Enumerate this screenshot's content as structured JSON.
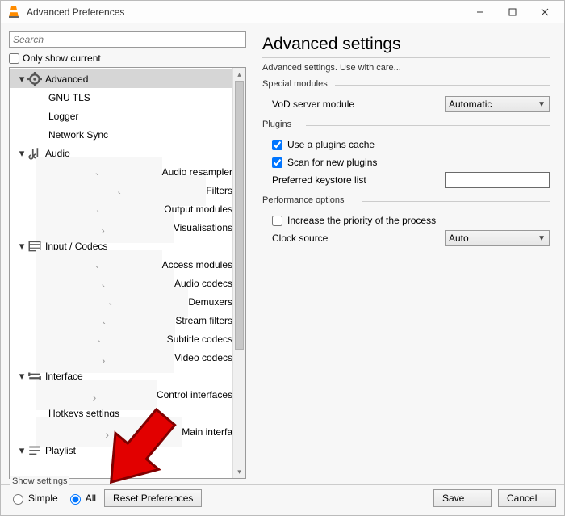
{
  "window": {
    "title": "Advanced Preferences"
  },
  "search": {
    "placeholder": "Search"
  },
  "only_current_label": "Only show current",
  "tree": {
    "advanced": {
      "label": "Advanced"
    },
    "gnu_tls": {
      "label": "GNU TLS"
    },
    "logger": {
      "label": "Logger"
    },
    "network_sync": {
      "label": "Network Sync"
    },
    "audio": {
      "label": "Audio"
    },
    "audio_resampler": {
      "label": "Audio resampler"
    },
    "filters": {
      "label": "Filters"
    },
    "output_modules": {
      "label": "Output modules"
    },
    "visualisations": {
      "label": "Visualisations"
    },
    "input_codecs": {
      "label": "Input / Codecs"
    },
    "access_modules": {
      "label": "Access modules"
    },
    "audio_codecs": {
      "label": "Audio codecs"
    },
    "demuxers": {
      "label": "Demuxers"
    },
    "stream_filters": {
      "label": "Stream filters"
    },
    "subtitle_codecs": {
      "label": "Subtitle codecs"
    },
    "video_codecs": {
      "label": "Video codecs"
    },
    "interface": {
      "label": "Interface"
    },
    "control_interfaces": {
      "label": "Control interfaces"
    },
    "hotkeys_settings": {
      "label": "Hotkeys settings"
    },
    "main_interfaces": {
      "label": "Main interfa"
    },
    "playlist": {
      "label": "Playlist"
    }
  },
  "right": {
    "heading": "Advanced settings",
    "subtitle": "Advanced settings. Use with care...",
    "group_special": "Special modules",
    "vod_label": "VoD server module",
    "vod_value": "Automatic",
    "group_plugins": "Plugins",
    "use_cache": "Use a plugins cache",
    "scan_new": "Scan for new plugins",
    "keystore_label": "Preferred keystore list",
    "group_perf": "Performance options",
    "increase_priority": "Increase the priority of the process",
    "clock_label": "Clock source",
    "clock_value": "Auto"
  },
  "footer": {
    "show_settings": "Show settings",
    "simple": "Simple",
    "all": "All",
    "reset": "Reset Preferences",
    "save": "Save",
    "cancel": "Cancel"
  }
}
